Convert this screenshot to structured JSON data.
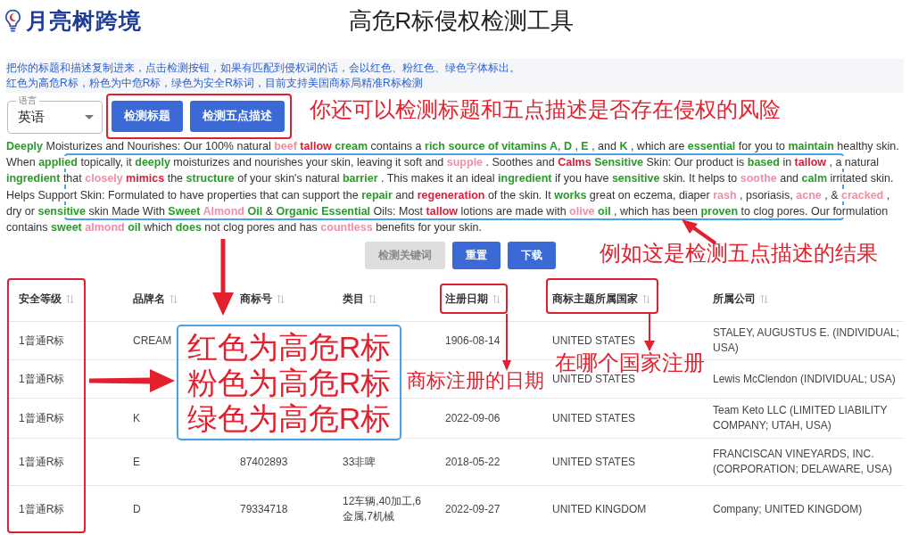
{
  "header": {
    "logo_text": "月亮树跨境",
    "title": "高危R标侵权检测工具"
  },
  "instructions": [
    "把你的标题和描述复制进来，点击检测按钮，如果有匹配到侵权词的话，会以红色、粉红色、绿色字体标出。",
    "红色为高危R标，粉色为中危R标，绿色为安全R标词，目前支持美国商标局精准R标检测"
  ],
  "language_select": {
    "label": "语言",
    "value": "英语"
  },
  "check_buttons": [
    {
      "label": "检测标题"
    },
    {
      "label": "检测五点描述"
    }
  ],
  "result_text": [
    {
      "text": "Deeply",
      "color": "#2b9a2b"
    },
    {
      "text": " Moisturizes and Nourishes: Our 100% natural "
    },
    {
      "text": "beef ",
      "color": "#ef8fa6"
    },
    {
      "text": "tallow ",
      "color": "#dc1e3c"
    },
    {
      "text": "cream",
      "color": "#2b9a2b"
    },
    {
      "text": " contains a "
    },
    {
      "text": "rich source of vitamins A",
      "color": "#2b9a2b"
    },
    {
      "text": ", "
    },
    {
      "text": "D",
      "color": "#2b9a2b"
    },
    {
      "text": " , "
    },
    {
      "text": "E",
      "color": "#2b9a2b"
    },
    {
      "text": " , and "
    },
    {
      "text": "K",
      "color": "#2b9a2b"
    },
    {
      "text": " , which are "
    },
    {
      "text": "essential",
      "color": "#2b9a2b"
    },
    {
      "text": " for you to "
    },
    {
      "text": "maintain",
      "color": "#2b9a2b"
    },
    {
      "text": " healthy skin. When "
    },
    {
      "text": "applied",
      "color": "#2b9a2b"
    },
    {
      "text": " topically, it "
    },
    {
      "text": "deeply",
      "color": "#2b9a2b"
    },
    {
      "text": " moisturizes and nourishes your skin, leaving it soft and "
    },
    {
      "text": "supple",
      "color": "#ef8fa6"
    },
    {
      "text": " . Soothes and "
    },
    {
      "text": "Calms ",
      "color": "#dc1e3c"
    },
    {
      "text": "Sensitive",
      "color": "#2b9a2b"
    },
    {
      "text": " Skin: Our product is "
    },
    {
      "text": "based",
      "color": "#2b9a2b"
    },
    {
      "text": " in "
    },
    {
      "text": "tallow",
      "color": "#dc1e3c"
    },
    {
      "text": " , a natural "
    },
    {
      "text": "ingredient",
      "color": "#2b9a2b"
    },
    {
      "text": " that "
    },
    {
      "text": "closely ",
      "color": "#ef8fa6"
    },
    {
      "text": "mimics",
      "color": "#dc1e3c"
    },
    {
      "text": " the "
    },
    {
      "text": "structure",
      "color": "#2b9a2b"
    },
    {
      "text": " of your skin's natural "
    },
    {
      "text": "barrier",
      "color": "#2b9a2b"
    },
    {
      "text": " . This makes it an ideal "
    },
    {
      "text": "ingredient",
      "color": "#2b9a2b"
    },
    {
      "text": " if you have "
    },
    {
      "text": "sensitive",
      "color": "#2b9a2b"
    },
    {
      "text": " skin. It helps to "
    },
    {
      "text": "soothe",
      "color": "#ef8fa6"
    },
    {
      "text": " and "
    },
    {
      "text": "calm",
      "color": "#2b9a2b"
    },
    {
      "text": " irritated skin. Helps Support Skin: Formulated to have properties that can support the "
    },
    {
      "text": "repair",
      "color": "#2b9a2b"
    },
    {
      "text": " and "
    },
    {
      "text": "regeneration",
      "color": "#dc1e3c"
    },
    {
      "text": " of the skin. It "
    },
    {
      "text": "works",
      "color": "#2b9a2b"
    },
    {
      "text": " great on eczema, diaper "
    },
    {
      "text": "rash",
      "color": "#ef8fa6"
    },
    {
      "text": " , psoriasis, "
    },
    {
      "text": "acne",
      "color": "#ef8fa6"
    },
    {
      "text": " , & "
    },
    {
      "text": "cracked",
      "color": "#ef8fa6"
    },
    {
      "text": " , dry or "
    },
    {
      "text": "sensitive",
      "color": "#2b9a2b"
    },
    {
      "text": " skin Made With "
    },
    {
      "text": "Sweet ",
      "color": "#2b9a2b"
    },
    {
      "text": "Almond ",
      "color": "#ef8fa6"
    },
    {
      "text": "Oil",
      "color": "#2b9a2b"
    },
    {
      "text": " & "
    },
    {
      "text": "Organic Essential",
      "color": "#2b9a2b"
    },
    {
      "text": " Oils: Most "
    },
    {
      "text": "tallow",
      "color": "#dc1e3c"
    },
    {
      "text": " lotions are made with "
    },
    {
      "text": "olive ",
      "color": "#ef8fa6"
    },
    {
      "text": "oil",
      "color": "#2b9a2b"
    },
    {
      "text": " , which has been "
    },
    {
      "text": "proven",
      "color": "#2b9a2b"
    },
    {
      "text": " to clog pores. Our formulation contains "
    },
    {
      "text": "sweet ",
      "color": "#2b9a2b"
    },
    {
      "text": "almond ",
      "color": "#ef8fa6"
    },
    {
      "text": "oil",
      "color": "#2b9a2b"
    },
    {
      "text": " which "
    },
    {
      "text": "does",
      "color": "#2b9a2b"
    },
    {
      "text": " not clog pores and has "
    },
    {
      "text": "countless",
      "color": "#ef8fa6"
    },
    {
      "text": " benefits for your skin."
    }
  ],
  "action_buttons": [
    {
      "label": "检测关键词",
      "disabled": true
    },
    {
      "label": "重置",
      "disabled": false
    },
    {
      "label": "下载",
      "disabled": false
    }
  ],
  "table": {
    "columns": [
      "安全等级",
      "品牌名",
      "商标号",
      "类目",
      "注册日期",
      "商标主题所属国家",
      "所属公司"
    ],
    "rows": [
      {
        "safety_level": "1普通R标",
        "brand": "CREAM",
        "registration_date": "1906-08-14",
        "country": "UNITED STATES",
        "company": "STALEY, AUGUSTUS E. (INDIVIDUAL; USA)"
      },
      {
        "safety_level": "1普通R标",
        "country": "UNITED STATES",
        "company": "Lewis McClendon (INDIVIDUAL; USA)"
      },
      {
        "safety_level": "1普通R标",
        "brand": "K",
        "registration_date": "2022-09-06",
        "country": "UNITED STATES",
        "company": "Team Keto LLC (LIMITED LIABILITY COMPANY; UTAH, USA)"
      },
      {
        "safety_level": "1普通R标",
        "brand": "E",
        "trademark_no": "87402893",
        "category": "33非啤",
        "registration_date": "2018-05-22",
        "country": "UNITED STATES",
        "company": "FRANCISCAN VINEYARDS, INC. (CORPORATION; DELAWARE, USA)"
      },
      {
        "safety_level": "1普通R标",
        "brand": "D",
        "trademark_no": "79334718",
        "category": "12车辆,40加工,6金属,7机械",
        "registration_date": "2022-09-27",
        "country": "UNITED KINGDOM",
        "company": "Company; UNITED KINGDOM)"
      }
    ]
  },
  "annotations": {
    "buttons_note": "你还可以检测标题和五点描述是否存在侵权的风险",
    "result_note": "例如这是检测五点描述的结果",
    "legend_lines": [
      "红色为高危R标",
      "粉色为高危R标",
      "绿色为高危R标"
    ],
    "date_note": "商标注册的日期",
    "country_note": "在哪个国家注册"
  }
}
